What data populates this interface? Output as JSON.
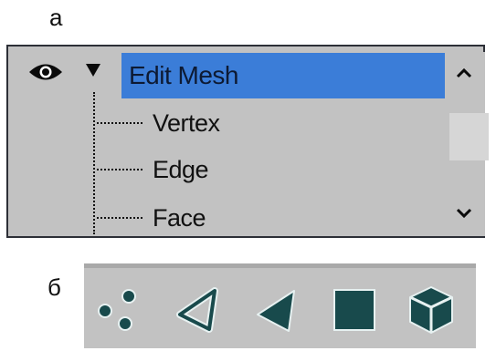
{
  "labels": {
    "panel_a": "а",
    "panel_b": "б"
  },
  "stack": {
    "modifier": "Edit Mesh",
    "sub_objects": [
      "Vertex",
      "Edge",
      "Face"
    ],
    "visibility_icon": "eye-icon",
    "expand_icon": "expand-triangle-icon",
    "scroll_up_icon": "chevron-up-icon",
    "scroll_down_icon": "chevron-down-icon"
  },
  "toolbar": {
    "buttons": [
      {
        "name": "vertex",
        "icon": "vertex-dots-icon"
      },
      {
        "name": "edge",
        "icon": "edge-triangle-icon"
      },
      {
        "name": "face",
        "icon": "face-triangle-icon"
      },
      {
        "name": "polygon",
        "icon": "polygon-square-icon"
      },
      {
        "name": "element",
        "icon": "element-cube-icon"
      }
    ]
  },
  "colors": {
    "selection": "#3b7dd8",
    "panel_bg": "#c2c2c2",
    "icon_fill": "#184a4c",
    "icon_outline": "#e7f1f1"
  }
}
